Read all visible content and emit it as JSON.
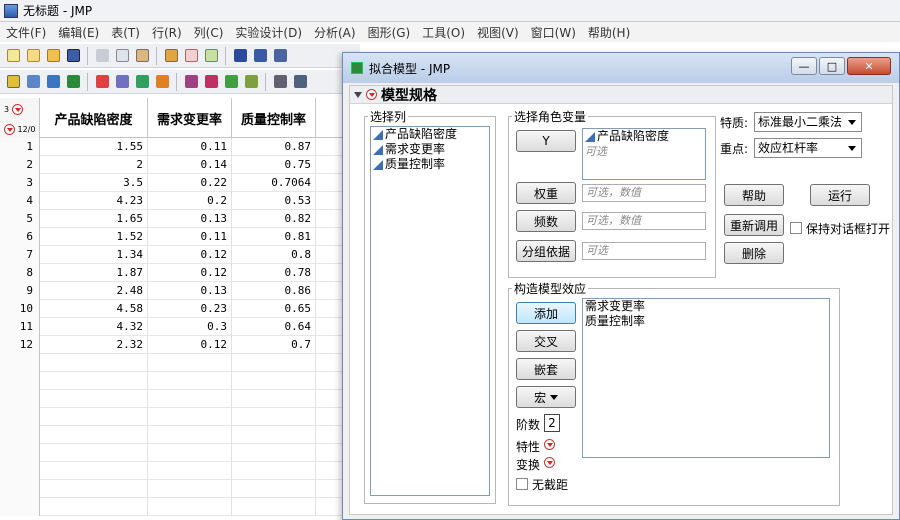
{
  "window": {
    "title": "无标题 - JMP"
  },
  "menu": [
    "文件(F)",
    "编辑(E)",
    "表(T)",
    "行(R)",
    "列(C)",
    "实验设计(D)",
    "分析(A)",
    "图形(G)",
    "工具(O)",
    "视图(V)",
    "窗口(W)",
    "帮助(H)"
  ],
  "table": {
    "corner_top": "3",
    "corner_bottom": "12/0",
    "columns": [
      "产品缺陷密度",
      "需求变更率",
      "质量控制率"
    ],
    "rows": [
      [
        "1",
        "1.55",
        "0.11",
        "0.87"
      ],
      [
        "2",
        "2",
        "0.14",
        "0.75"
      ],
      [
        "3",
        "3.5",
        "0.22",
        "0.7064"
      ],
      [
        "4",
        "4.23",
        "0.2",
        "0.53"
      ],
      [
        "5",
        "1.65",
        "0.13",
        "0.82"
      ],
      [
        "6",
        "1.52",
        "0.11",
        "0.81"
      ],
      [
        "7",
        "1.34",
        "0.12",
        "0.8"
      ],
      [
        "8",
        "1.87",
        "0.12",
        "0.78"
      ],
      [
        "9",
        "2.48",
        "0.13",
        "0.86"
      ],
      [
        "10",
        "4.58",
        "0.23",
        "0.65"
      ],
      [
        "11",
        "4.32",
        "0.3",
        "0.64"
      ],
      [
        "12",
        "2.32",
        "0.12",
        "0.7"
      ]
    ]
  },
  "dialog": {
    "title": "拟合模型 - JMP",
    "spec_title": "模型规格",
    "select_columns_label": "选择列",
    "columns": [
      "产品缺陷密度",
      "需求变更率",
      "质量控制率"
    ],
    "roles_label": "选择角色变量",
    "y_button": "Y",
    "y_value": "产品缺陷密度",
    "y_optional": "可选",
    "weight_button": "权重",
    "weight_placeholder": "可选，数值",
    "freq_button": "频数",
    "freq_placeholder": "可选，数值",
    "by_button": "分组依据",
    "by_placeholder": "可选",
    "personality_label": "特质:",
    "personality_value": "标准最小二乘法",
    "emphasis_label": "重点:",
    "emphasis_value": "效应杠杆率",
    "help_button": "帮助",
    "run_button": "运行",
    "recall_button": "重新调用",
    "keep_open_label": "保持对话框打开",
    "remove_button": "删除",
    "effects_label": "构造模型效应",
    "add_button": "添加",
    "cross_button": "交叉",
    "nest_button": "嵌套",
    "macros_button": "宏",
    "degree_label": "阶数",
    "degree_value": "2",
    "attributes_label": "特性",
    "transform_label": "变换",
    "no_intercept_label": "无截距",
    "effects": [
      "需求变更率",
      "质量控制率"
    ]
  }
}
